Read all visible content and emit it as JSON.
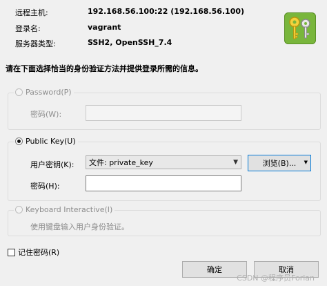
{
  "header": {
    "remote_host_label": "远程主机:",
    "remote_host_value": "192.168.56.100:22 (192.168.56.100)",
    "login_label": "登录名:",
    "login_value": "vagrant",
    "server_type_label": "服务器类型:",
    "server_type_value": "SSH2, OpenSSH_7.4",
    "icon": "keys-icon"
  },
  "instruction": "请在下面选择恰当的身份验证方法并提供登录所需的信息。",
  "password_group": {
    "radio_label": "Password(P)",
    "password_label": "密码(W):",
    "password_value": "",
    "selected": false,
    "enabled": false
  },
  "publickey_group": {
    "radio_label": "Public Key(U)",
    "selected": true,
    "user_key_label": "用户密钥(K):",
    "user_key_value": "文件: private_key",
    "browse_label": "浏览(B)...",
    "passphrase_label": "密码(H):",
    "passphrase_value": ""
  },
  "keyboard_group": {
    "radio_label": "Keyboard Interactive(I)",
    "description": "使用键盘输入用户身份验证。",
    "selected": false,
    "enabled": false
  },
  "remember_password_label": "记住密码(R)",
  "remember_password_checked": false,
  "ok_label": "确定",
  "cancel_label": "取消",
  "watermark": "CSDN @程序员Forlan"
}
